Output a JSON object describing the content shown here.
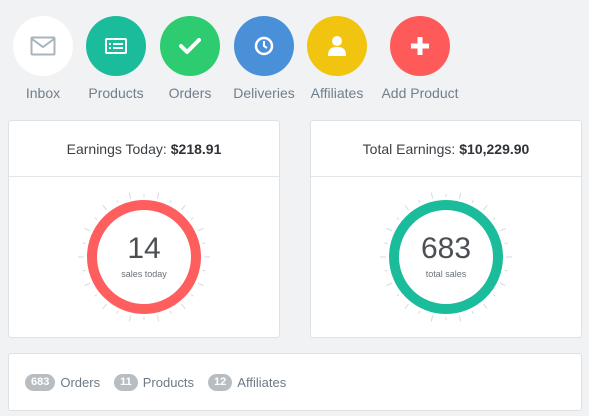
{
  "nav": {
    "items": [
      {
        "label": "Inbox",
        "icon": "envelope-icon",
        "color": "#ffffff"
      },
      {
        "label": "Products",
        "icon": "list-icon",
        "color": "#1abc9c"
      },
      {
        "label": "Orders",
        "icon": "check-icon",
        "color": "#2ecc71"
      },
      {
        "label": "Deliveries",
        "icon": "clock-icon",
        "color": "#4a90d9"
      },
      {
        "label": "Affiliates",
        "icon": "user-icon",
        "color": "#f1c40f"
      },
      {
        "label": "Add Product",
        "icon": "plus-icon",
        "color": "#ff5a5a"
      }
    ]
  },
  "earnings_today": {
    "title": "Earnings Today:",
    "amount": "$218.91",
    "count": "14",
    "sublabel": "sales today",
    "ring_color": "#ff5e5e"
  },
  "total_earnings": {
    "title": "Total Earnings:",
    "amount": "$10,229.90",
    "count": "683",
    "sublabel": "total sales",
    "ring_color": "#1abc9c"
  },
  "summary": {
    "orders_count": "683",
    "orders_label": "Orders",
    "products_count": "11",
    "products_label": "Products",
    "affiliates_count": "12",
    "affiliates_label": "Affiliates"
  }
}
